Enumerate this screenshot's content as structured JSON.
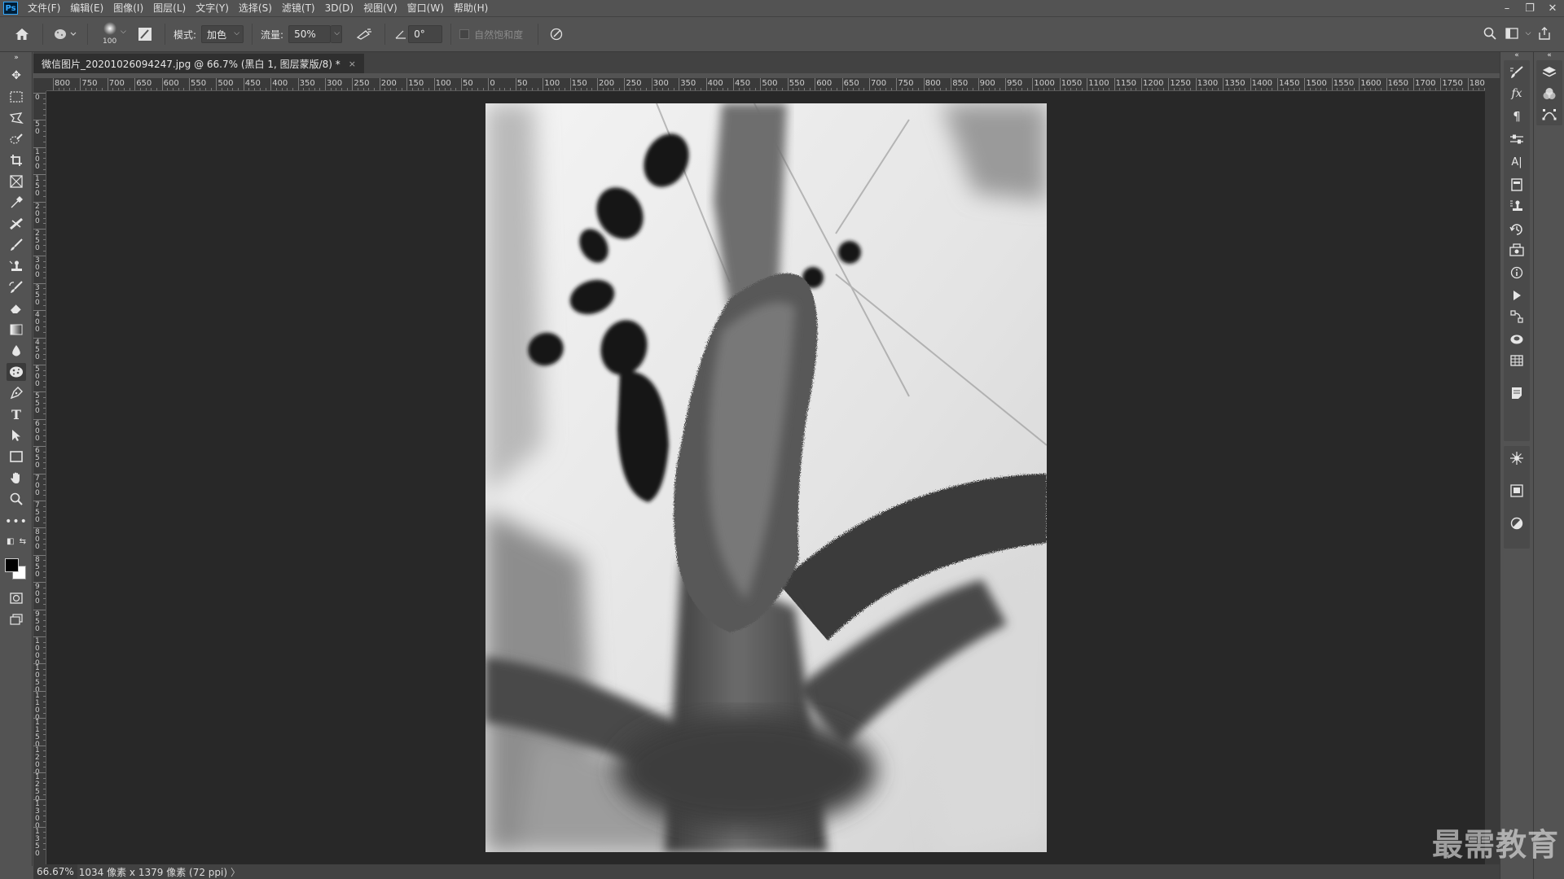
{
  "app": {
    "logo_text": "Ps",
    "menu": [
      "文件(F)",
      "编辑(E)",
      "图像(I)",
      "图层(L)",
      "文字(Y)",
      "选择(S)",
      "滤镜(T)",
      "3D(D)",
      "视图(V)",
      "窗口(W)",
      "帮助(H)"
    ],
    "window_controls": [
      "minimize-icon",
      "restore-icon",
      "close-icon"
    ]
  },
  "options": {
    "brush_size": "100",
    "mode_label": "模式:",
    "mode_value": "加色",
    "flow_label": "流量:",
    "flow_value": "50%",
    "angle_value": "0°",
    "vibrance_label": "自然饱和度"
  },
  "document": {
    "tab_title": "微信图片_20201026094247.jpg @ 66.7% (黑白 1, 图层蒙版/8) *",
    "close_glyph": "×"
  },
  "ruler": {
    "h_labels": [
      "800",
      "750",
      "700",
      "650",
      "600",
      "550",
      "500",
      "450",
      "400",
      "350",
      "300",
      "250",
      "200",
      "150",
      "100",
      "50",
      "0",
      "50",
      "100",
      "150",
      "200",
      "250",
      "300",
      "350",
      "400",
      "450",
      "500",
      "550",
      "600",
      "650",
      "700",
      "750",
      "800",
      "850",
      "900",
      "950",
      "1000",
      "1050",
      "1100",
      "1150",
      "1200",
      "1250",
      "1300",
      "1350",
      "1400",
      "1450",
      "1500",
      "1550",
      "1600",
      "1650",
      "1700",
      "1750",
      "1800"
    ],
    "v_labels": [
      "0",
      "50",
      "100",
      "150",
      "200",
      "250",
      "300",
      "350",
      "400",
      "450",
      "500",
      "550",
      "600",
      "650",
      "700",
      "750",
      "800",
      "850",
      "900",
      "950",
      "1000",
      "1050",
      "1100",
      "1150",
      "1200",
      "1250",
      "1300",
      "1350"
    ]
  },
  "status": {
    "zoom": "66.67%",
    "info": "1034 像素 x 1379 像素 (72 ppi)",
    "arrow": "〉"
  },
  "watermark": "最需教育",
  "colors": {
    "foreground": "#000000",
    "background": "#ffffff"
  }
}
